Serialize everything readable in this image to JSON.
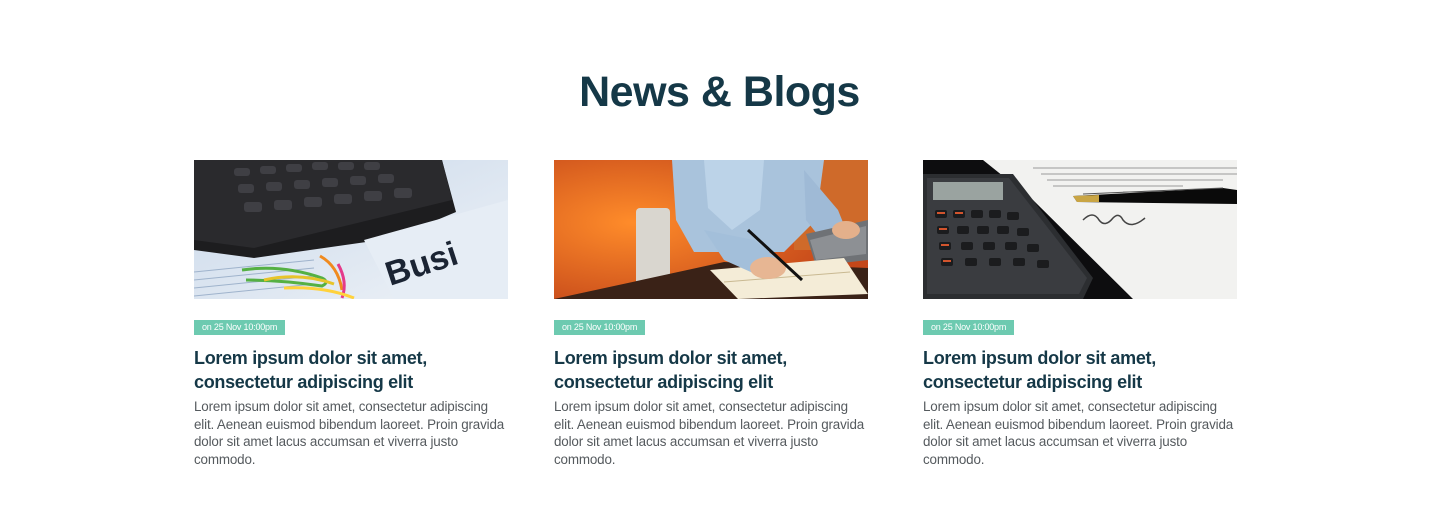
{
  "section": {
    "title": "News & Blogs"
  },
  "posts": [
    {
      "image_icon": "calculator-business-image",
      "date": "on 25 Nov 10:00pm",
      "title": "Lorem ipsum dolor sit amet, consectetur adipiscing elit",
      "excerpt": "Lorem ipsum dolor sit amet, consectetur adipiscing elit. Aenean euismod bibendum laoreet. Proin gravida dolor sit amet lacus accumsan et viverra justo commodo."
    },
    {
      "image_icon": "person-writing-image",
      "date": "on 25 Nov 10:00pm",
      "title": "Lorem ipsum dolor sit amet, consectetur adipiscing elit",
      "excerpt": "Lorem ipsum dolor sit amet, consectetur adipiscing elit. Aenean euismod bibendum laoreet. Proin gravida dolor sit amet lacus accumsan et viverra justo commodo."
    },
    {
      "image_icon": "calculator-pen-image",
      "date": "on 25 Nov 10:00pm",
      "title": "Lorem ipsum dolor sit amet, consectetur adipiscing elit",
      "excerpt": "Lorem ipsum dolor sit amet, consectetur adipiscing elit. Aenean euismod bibendum laoreet. Proin gravida dolor sit amet lacus accumsan et viverra justo commodo."
    }
  ],
  "colors": {
    "heading": "#153847",
    "badge": "#6dcab0",
    "body_text": "#555a5e"
  }
}
